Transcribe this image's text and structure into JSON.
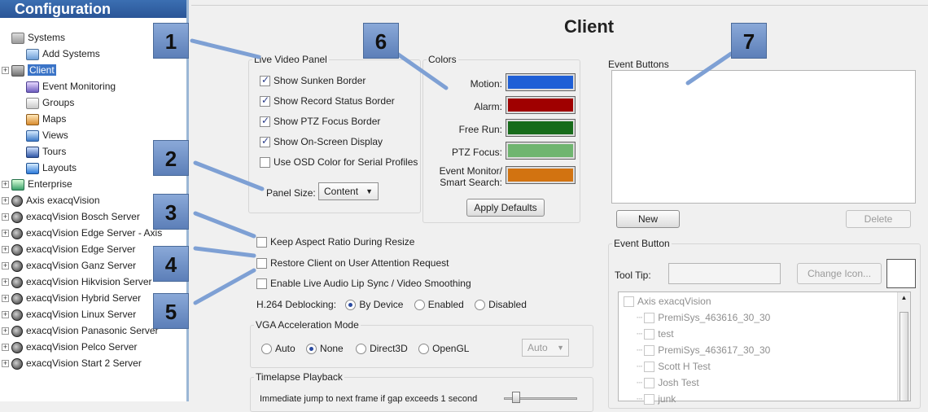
{
  "tree": {
    "header": "Configuration",
    "items": [
      {
        "label": "Systems",
        "icon": "systems-icon",
        "expander": "",
        "indent": 0
      },
      {
        "label": "Add Systems",
        "icon": "add-systems-icon",
        "expander": "",
        "indent": 1
      },
      {
        "label": "Client",
        "icon": "client-icon",
        "expander": "+",
        "indent": 0,
        "selected": true
      },
      {
        "label": "Event Monitoring",
        "icon": "event-monitoring-icon",
        "expander": "",
        "indent": 1
      },
      {
        "label": "Groups",
        "icon": "groups-icon",
        "expander": "",
        "indent": 1
      },
      {
        "label": "Maps",
        "icon": "maps-icon",
        "expander": "",
        "indent": 1
      },
      {
        "label": "Views",
        "icon": "views-icon",
        "expander": "",
        "indent": 1
      },
      {
        "label": "Tours",
        "icon": "tours-icon",
        "expander": "",
        "indent": 1
      },
      {
        "label": "Layouts",
        "icon": "layouts-icon",
        "expander": "",
        "indent": 1
      },
      {
        "label": "Enterprise",
        "icon": "enterprise-icon",
        "expander": "+",
        "indent": 0
      },
      {
        "label": "Axis  exacqVision",
        "icon": "server-icon",
        "expander": "+",
        "indent": 0
      },
      {
        "label": "exacqVision Bosch Server",
        "icon": "server-icon",
        "expander": "+",
        "indent": 0
      },
      {
        "label": "exacqVision Edge Server - Axis",
        "icon": "server-icon",
        "expander": "+",
        "indent": 0
      },
      {
        "label": "exacqVision Edge Server",
        "icon": "server-icon",
        "expander": "+",
        "indent": 0
      },
      {
        "label": "exacqVision Ganz Server",
        "icon": "server-icon",
        "expander": "+",
        "indent": 0
      },
      {
        "label": "exacqVision Hikvision Server",
        "icon": "server-icon",
        "expander": "+",
        "indent": 0
      },
      {
        "label": "exacqVision Hybrid Server",
        "icon": "server-icon",
        "expander": "+",
        "indent": 0
      },
      {
        "label": "exacqVision Linux Server",
        "icon": "server-icon",
        "expander": "+",
        "indent": 0
      },
      {
        "label": "exacqVision Panasonic Server",
        "icon": "server-icon",
        "expander": "+",
        "indent": 0
      },
      {
        "label": "exacqVision Pelco Server",
        "icon": "server-icon",
        "expander": "+",
        "indent": 0
      },
      {
        "label": "exacqVision Start 2 Server",
        "icon": "server-icon",
        "expander": "+",
        "indent": 0
      }
    ]
  },
  "page_title": "Client",
  "live_video": {
    "legend": "Live Video Panel",
    "options": [
      {
        "label": "Show Sunken Border",
        "checked": true
      },
      {
        "label": "Show Record Status Border",
        "checked": true
      },
      {
        "label": "Show PTZ Focus Border",
        "checked": true
      },
      {
        "label": "Show On-Screen Display",
        "checked": true
      },
      {
        "label": "Use OSD Color for Serial Profiles",
        "checked": false
      }
    ],
    "panel_size_label": "Panel Size:",
    "panel_size_value": "Content"
  },
  "colors": {
    "legend": "Colors",
    "items": [
      {
        "label": "Motion:",
        "color": "#1f5fd6"
      },
      {
        "label": "Alarm:",
        "color": "#a00000"
      },
      {
        "label": "Free Run:",
        "color": "#176b1a"
      },
      {
        "label": "PTZ Focus:",
        "color": "#6fb56f"
      },
      {
        "label": "Event Monitor/\nSmart Search:",
        "color": "#d27311"
      }
    ],
    "apply_label": "Apply Defaults"
  },
  "general": {
    "options": [
      {
        "label": "Keep Aspect Ratio During Resize",
        "checked": false
      },
      {
        "label": "Restore Client on User Attention Request",
        "checked": false
      },
      {
        "label": "Enable Live Audio Lip Sync / Video Smoothing",
        "checked": false
      }
    ],
    "deblock_label": "H.264 Deblocking:",
    "deblock_options": [
      "By Device",
      "Enabled",
      "Disabled"
    ],
    "deblock_selected": "By Device"
  },
  "vga": {
    "legend": "VGA Acceleration Mode",
    "options": [
      "Auto",
      "None",
      "Direct3D",
      "OpenGL"
    ],
    "selected": "None",
    "select_value": "Auto"
  },
  "timelapse": {
    "legend": "Timelapse Playback",
    "text": "Immediate jump to next frame if gap exceeds 1 second"
  },
  "event_buttons": {
    "legend": "Event Buttons",
    "new_label": "New",
    "delete_label": "Delete"
  },
  "event_button": {
    "legend": "Event Button",
    "tooltip_label": "Tool Tip:",
    "change_icon_label": "Change Icon...",
    "list": [
      {
        "label": "Axis  exacqVision",
        "level": 0
      },
      {
        "label": "PremiSys_463616_30_30",
        "level": 1
      },
      {
        "label": "test",
        "level": 1
      },
      {
        "label": "PremiSys_463617_30_30",
        "level": 1
      },
      {
        "label": "Scott H Test",
        "level": 1
      },
      {
        "label": "Josh Test",
        "level": 1
      },
      {
        "label": "junk",
        "level": 1
      }
    ]
  },
  "callouts": [
    "1",
    "2",
    "3",
    "4",
    "5",
    "6",
    "7"
  ]
}
